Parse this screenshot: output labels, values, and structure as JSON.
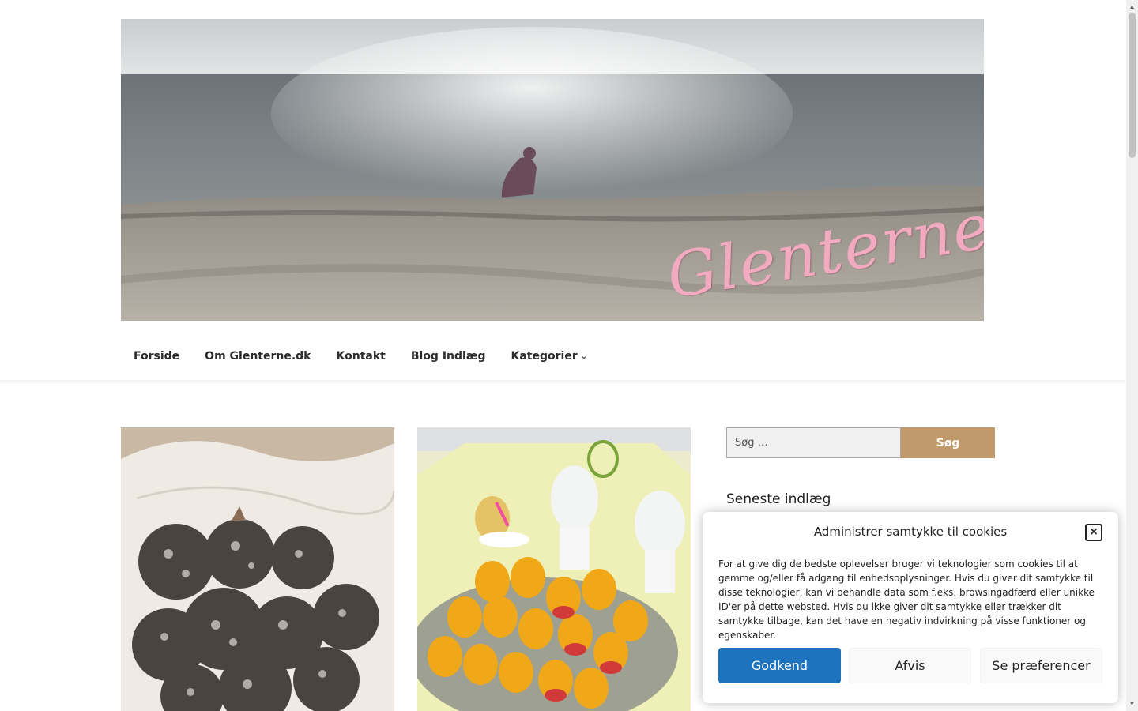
{
  "site": {
    "banner_title": "Glenterne"
  },
  "nav": {
    "items": [
      {
        "label": "Forside"
      },
      {
        "label": "Om Glenterne.dk"
      },
      {
        "label": "Kontakt"
      },
      {
        "label": "Blog Indlæg"
      },
      {
        "label": "Kategorier",
        "has_dropdown": true
      }
    ]
  },
  "search": {
    "placeholder": "Søg …",
    "button_label": "Søg"
  },
  "sidebar": {
    "recent_posts_title": "Seneste indlæg"
  },
  "cookie": {
    "title": "Administrer samtykke til cookies",
    "text": "For at give dig de bedste oplevelser bruger vi teknologier som cookies til at gemme og/eller få adgang til enhedsoplysninger. Hvis du giver dit samtykke til disse teknologier, kan vi behandle data som f.eks. browsingadfærd eller unikke ID'er på dette websted. Hvis du ikke giver dit samtykke eller trækker dit samtykke tilbage, kan det have en negativ indvirkning på visse funktioner og egenskaber.",
    "accept_label": "Godkend",
    "deny_label": "Afvis",
    "prefs_label": "Se præferencer"
  },
  "colors": {
    "accent": "#c19a6b",
    "primary_button": "#1e73be",
    "banner_text": "#f2aac0"
  },
  "icons": {
    "close": "close-icon",
    "dropdown": "chevron-down-icon"
  }
}
